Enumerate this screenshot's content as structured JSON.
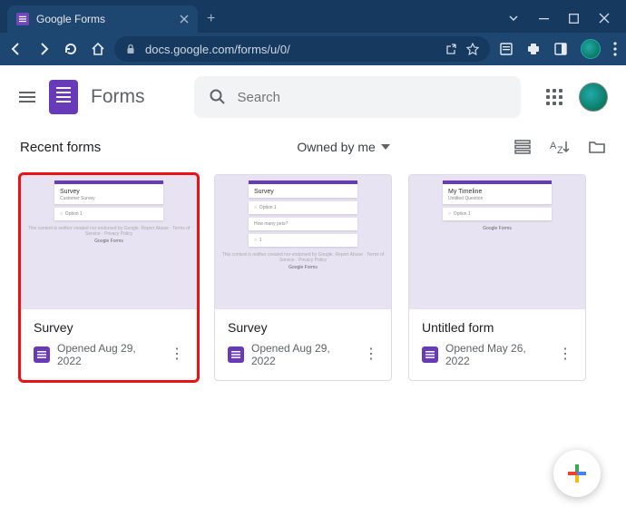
{
  "browser": {
    "tab_title": "Google Forms",
    "url": "docs.google.com/forms/u/0/"
  },
  "header": {
    "app_name": "Forms",
    "search_placeholder": "Search"
  },
  "recent": {
    "title": "Recent forms",
    "filter_label": "Owned by me"
  },
  "forms": [
    {
      "title": "Survey",
      "opened": "Opened Aug 29, 2022",
      "thumb_title": "Survey",
      "thumb_sub": "Customer Survey",
      "highlighted": true
    },
    {
      "title": "Survey",
      "opened": "Opened Aug 29, 2022",
      "thumb_title": "Survey",
      "thumb_sub": "",
      "highlighted": false
    },
    {
      "title": "Untitled form",
      "opened": "Opened May 26, 2022",
      "thumb_title": "My Timeline",
      "thumb_sub": "Untitled Question",
      "highlighted": false
    }
  ],
  "thumb_brand": "Google Forms"
}
